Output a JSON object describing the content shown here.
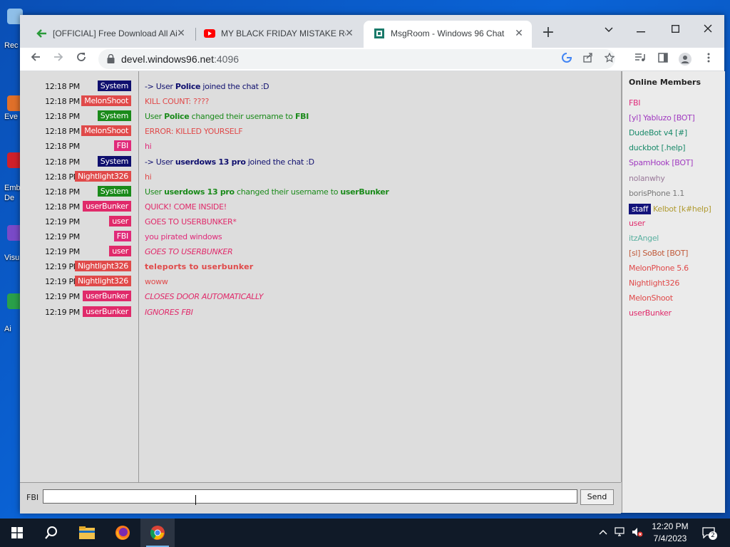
{
  "desktop": {
    "icons": [
      {
        "label": "Rec",
        "color": "#8fbfe8"
      },
      {
        "label": "Eve",
        "color": "#e0702a"
      },
      {
        "label": "Emb",
        "label2": "De",
        "color": "#d0202a"
      },
      {
        "label": "Visu",
        "color": "#7a4ac8"
      },
      {
        "label": "Ai",
        "color": "#2aa04a"
      }
    ]
  },
  "browser": {
    "tabs": [
      {
        "title": "[OFFICIAL] Free Download All Ai",
        "favicon": "arrow-icon",
        "close": "✕"
      },
      {
        "title": "MY BLACK FRIDAY MISTAKE Rene",
        "favicon": "youtube-icon",
        "close": "✕"
      },
      {
        "title": "MsgRoom - Windows 96 Chat",
        "favicon": "msgroom-icon",
        "close": "✕"
      }
    ],
    "new_tab": "+",
    "url_host": "devel.windows96.net",
    "url_port": ":4096"
  },
  "chat": {
    "messages": [
      {
        "time": "12:18 PM",
        "user": "System",
        "user_bg": "#0f0f6e",
        "text_color": "#0f0f6e",
        "style": "normal",
        "parts": [
          "-> User ",
          "Police",
          " joined the chat :D"
        ]
      },
      {
        "time": "12:18 PM",
        "user": "MelonShoot",
        "user_bg": "#e04a4a",
        "text_color": "#e04a4a",
        "style": "normal",
        "parts": [
          "KILL COUNT: ????"
        ]
      },
      {
        "time": "12:18 PM",
        "user": "System",
        "user_bg": "#1a8a1a",
        "text_color": "#1a8a1a",
        "style": "normal",
        "parts": [
          "User ",
          "Police",
          " changed their username to ",
          "FBI"
        ]
      },
      {
        "time": "12:18 PM",
        "user": "MelonShoot",
        "user_bg": "#e04a4a",
        "text_color": "#e04a4a",
        "style": "normal",
        "parts": [
          "ERROR: KILLED YOURSELF"
        ]
      },
      {
        "time": "12:18 PM",
        "user": "FBI",
        "user_bg": "#e02a7a",
        "text_color": "#e02a7a",
        "style": "normal",
        "parts": [
          "hi"
        ]
      },
      {
        "time": "12:18 PM",
        "user": "System",
        "user_bg": "#0f0f6e",
        "text_color": "#0f0f6e",
        "style": "normal",
        "parts": [
          "-> User ",
          "userdows 13 pro",
          " joined the chat :D"
        ]
      },
      {
        "time": "12:18 PM",
        "user": "Nightlight326",
        "user_bg": "#e04a4a",
        "text_color": "#e04a4a",
        "style": "normal",
        "parts": [
          "hi"
        ]
      },
      {
        "time": "12:18 PM",
        "user": "System",
        "user_bg": "#1a8a1a",
        "text_color": "#1a8a1a",
        "style": "normal",
        "parts": [
          "User ",
          "userdows 13 pro",
          " changed their username to ",
          "userBunker"
        ]
      },
      {
        "time": "12:18 PM",
        "user": "userBunker",
        "user_bg": "#e02a6a",
        "text_color": "#e02a6a",
        "style": "normal",
        "parts": [
          "QUICK! COME INSIDE!"
        ]
      },
      {
        "time": "12:19 PM",
        "user": "user",
        "user_bg": "#e02a6a",
        "text_color": "#e02a6a",
        "style": "normal",
        "parts": [
          "GOES TO USERBUNKER*"
        ]
      },
      {
        "time": "12:19 PM",
        "user": "FBI",
        "user_bg": "#e02a7a",
        "text_color": "#e02a7a",
        "style": "normal",
        "parts": [
          "you pirated windows"
        ]
      },
      {
        "time": "12:19 PM",
        "user": "user",
        "user_bg": "#e02a6a",
        "text_color": "#e02a6a",
        "style": "italic",
        "parts": [
          "GOES TO USERBUNKER"
        ]
      },
      {
        "time": "12:19 PM",
        "user": "Nightlight326",
        "user_bg": "#e04a4a",
        "text_color": "#e04a4a",
        "style": "bold",
        "parts": [
          "teleports to userbunker"
        ]
      },
      {
        "time": "12:19 PM",
        "user": "Nightlight326",
        "user_bg": "#e04a4a",
        "text_color": "#e04a4a",
        "style": "normal",
        "parts": [
          "woww"
        ]
      },
      {
        "time": "12:19 PM",
        "user": "userBunker",
        "user_bg": "#e02a6a",
        "text_color": "#e02a6a",
        "style": "italic",
        "parts": [
          "CLOSES DOOR AUTOMATICALLY"
        ]
      },
      {
        "time": "12:19 PM",
        "user": "userBunker",
        "user_bg": "#e02a6a",
        "text_color": "#e02a6a",
        "style": "italic",
        "parts": [
          "IGNORES FBI"
        ]
      }
    ],
    "input_nick": "FBI",
    "input_value": "",
    "send_label": "Send"
  },
  "members": {
    "title": "Online Members",
    "list": [
      {
        "name": "FBI",
        "color": "#e02a7a"
      },
      {
        "name": "[yl] Yabluzo [BOT]",
        "color": "#a03ac0"
      },
      {
        "name": "DudeBot v4 [#]",
        "color": "#1a8a6a"
      },
      {
        "name": "duckbot [.help]",
        "color": "#1a8a6a"
      },
      {
        "name": "SpamHook [BOT]",
        "color": "#a03ac0"
      },
      {
        "name": "nolanwhy",
        "color": "#9a7a9a"
      },
      {
        "name": "borisPhone 1.1",
        "color": "#7a7a7a"
      },
      {
        "name": "Kelbot [k#help]",
        "color": "#b09a30",
        "badge": "staff"
      },
      {
        "name": "user",
        "color": "#e02a6a"
      },
      {
        "name": "itzAngel",
        "color": "#5ab0a0"
      },
      {
        "name": "[sl] SoBot [BOT]",
        "color": "#c05a3a"
      },
      {
        "name": "MelonPhone 5.6",
        "color": "#e04a4a"
      },
      {
        "name": "Nightlight326",
        "color": "#e04a4a"
      },
      {
        "name": "MelonShoot",
        "color": "#e04a4a"
      },
      {
        "name": "userBunker",
        "color": "#e02a6a"
      }
    ]
  },
  "taskbar": {
    "time": "12:20 PM",
    "date": "7/4/2023",
    "notification_count": "2"
  }
}
